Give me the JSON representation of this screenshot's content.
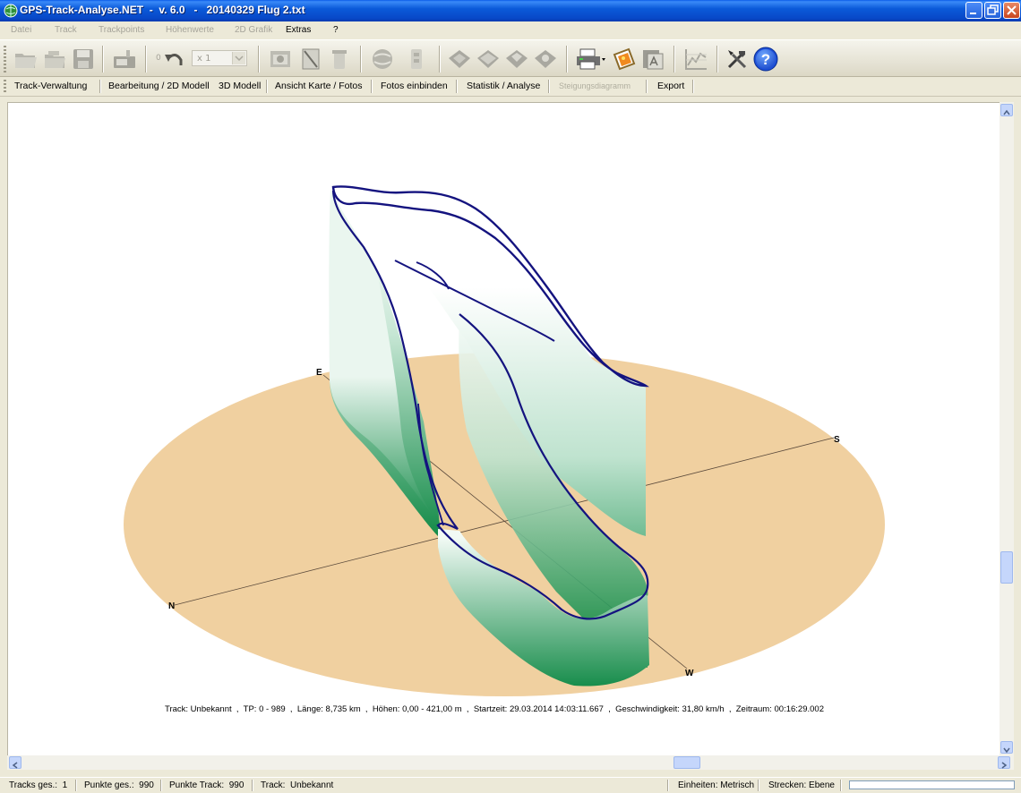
{
  "window": {
    "title": "GPS-Track-Analyse.NET  -  v. 6.0   -   20140329 Flug 2.txt"
  },
  "menu": {
    "items": [
      {
        "label": "Datei",
        "enabled": false
      },
      {
        "label": "Track",
        "enabled": false
      },
      {
        "label": "Trackpoints",
        "enabled": false
      },
      {
        "label": "Höhenwerte",
        "enabled": false
      },
      {
        "label": "2D Grafik",
        "enabled": false
      },
      {
        "label": "Extras",
        "enabled": true
      },
      {
        "label": "?",
        "enabled": true
      }
    ]
  },
  "toolbar": {
    "undo_count": "0",
    "zoom_value": "x 1",
    "icons": [
      "open-folder-icon",
      "open-multi-icon",
      "save-icon",
      "gps-device-icon",
      "undo-icon",
      "view-window-icon",
      "ruler-icon",
      "trash-icon",
      "globe-icon",
      "layers-icon",
      "map-1-icon",
      "map-2-icon",
      "map-3-icon",
      "map-4-icon",
      "printer-icon",
      "picture-icon",
      "export-image-icon",
      "chart-icon",
      "tools-icon",
      "help-icon"
    ]
  },
  "tabs": {
    "items": [
      {
        "label": "Track-Verwaltung",
        "enabled": true,
        "active": false
      },
      {
        "label": "Bearbeitung / 2D Modell",
        "enabled": true,
        "active": false
      },
      {
        "label": "3D Modell",
        "enabled": true,
        "active": true
      },
      {
        "label": "Ansicht Karte / Fotos",
        "enabled": true,
        "active": false
      },
      {
        "label": "Fotos einbinden",
        "enabled": true,
        "active": false
      },
      {
        "label": "Statistik / Analyse",
        "enabled": true,
        "active": false
      },
      {
        "label": "Steigungsdiagramm",
        "enabled": false,
        "active": false
      },
      {
        "label": "Export",
        "enabled": true,
        "active": false
      }
    ]
  },
  "scene": {
    "compass": {
      "n": "N",
      "e": "E",
      "s": "S",
      "w": "W"
    },
    "colors": {
      "ground": "#f0d0a0",
      "wall_top": "#ffffff",
      "wall_bottom": "#128a47",
      "track_line": "#14137f"
    },
    "info": "Track: Unbekannt  ,  TP: 0 - 989  ,  Länge: 8,735 km  ,  Höhen: 0,00 - 421,00 m  ,  Startzeit: 29.03.2014 14:03:11.667  ,  Geschwindigkeit: 31,80 km/h  ,  Zeitraum: 00:16:29.002"
  },
  "status": {
    "tracks_total": "Tracks ges.:  1",
    "points_total": "Punkte ges.:  990",
    "points_track": "Punkte Track:  990",
    "track_name": "Track:  Unbekannt",
    "units": "Einheiten: Metrisch",
    "segments": "Strecken: Ebene"
  }
}
